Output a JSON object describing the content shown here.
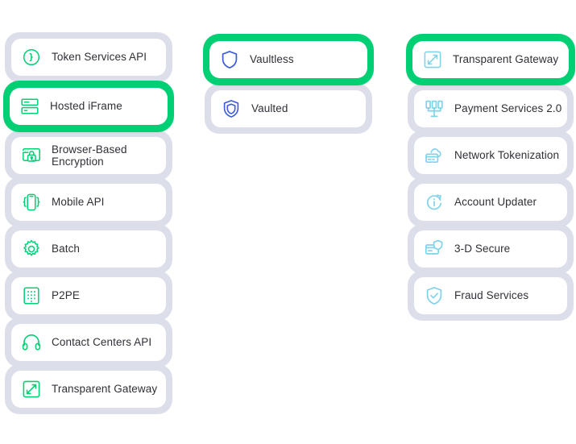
{
  "theme": {
    "accent_green": "#00cf74",
    "shell_lavender": "#dcdeea",
    "card_white": "#ffffff",
    "text_color": "#2f3037",
    "icon_green": "#00cf74",
    "icon_blue": "#3b5bdb",
    "icon_cyan": "#7fd3ea"
  },
  "columns": [
    {
      "id": "column-acceptance-methods",
      "icon_color": "#00cf74",
      "items": [
        {
          "label": "Token Services API",
          "icon": "braces-circle-icon",
          "active": false
        },
        {
          "label": "Hosted iFrame",
          "icon": "form-fields-icon",
          "active": true
        },
        {
          "label": "Browser-Based Encryption",
          "icon": "browser-lock-icon",
          "active": false
        },
        {
          "label": "Mobile API",
          "icon": "mobile-braces-icon",
          "active": false
        },
        {
          "label": "Batch",
          "icon": "gear-icon",
          "active": false
        },
        {
          "label": "P2PE",
          "icon": "keypad-icon",
          "active": false
        },
        {
          "label": "Contact Centers API",
          "icon": "headset-icon",
          "active": false
        },
        {
          "label": "Transparent Gateway",
          "icon": "expand-arrow-icon",
          "active": false
        }
      ]
    },
    {
      "id": "column-vault-options",
      "icon_color": "#3b5bdb",
      "items": [
        {
          "label": "Vaultless",
          "icon": "shield-icon",
          "active": true
        },
        {
          "label": "Vaulted",
          "icon": "shield-inner-icon",
          "active": false
        }
      ]
    },
    {
      "id": "column-services",
      "icon_color": "#7fd3ea",
      "items": [
        {
          "label": "Transparent Gateway",
          "icon": "expand-arrow-icon",
          "active": true
        },
        {
          "label": "Payment Services 2.0",
          "icon": "network-bars-icon",
          "active": false
        },
        {
          "label": "Network Tokenization",
          "icon": "cloud-card-icon",
          "active": false
        },
        {
          "label": "Account Updater",
          "icon": "info-refresh-icon",
          "active": false
        },
        {
          "label": "3-D Secure",
          "icon": "card-shield-icon",
          "active": false
        },
        {
          "label": "Fraud Services",
          "icon": "shield-check-icon",
          "active": false
        }
      ]
    }
  ]
}
